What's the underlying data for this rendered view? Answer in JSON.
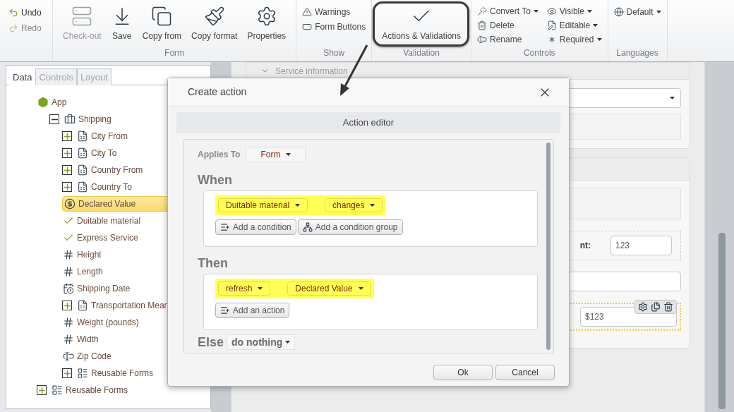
{
  "ribbon": {
    "quick": [
      {
        "label": "Undo",
        "disabled": false
      },
      {
        "label": "Redo",
        "disabled": true
      }
    ],
    "groups": [
      {
        "label": "Form",
        "items": [
          {
            "label": "Check-out",
            "kind": "large",
            "disabled": true
          },
          {
            "label": "Save",
            "kind": "large",
            "disabled": false
          },
          {
            "label": "Copy from",
            "kind": "large",
            "disabled": false
          },
          {
            "label": "Copy format",
            "kind": "large",
            "disabled": false
          },
          {
            "label": "Properties",
            "kind": "large",
            "disabled": false
          }
        ]
      },
      {
        "label": "Show",
        "items": [
          {
            "label": "Warnings",
            "kind": "small",
            "dropdown": false
          },
          {
            "label": "Form Buttons",
            "kind": "small",
            "dropdown": false
          }
        ]
      },
      {
        "label": "Validation",
        "items": [
          {
            "label": "Actions & Validations",
            "kind": "large",
            "disabled": false,
            "circled": true
          }
        ]
      },
      {
        "label": "Controls",
        "items": [
          {
            "label": "Convert To",
            "kind": "small",
            "dropdown": true
          },
          {
            "label": "Delete",
            "kind": "small",
            "dropdown": false
          },
          {
            "label": "Rename",
            "kind": "small",
            "dropdown": false
          },
          {
            "label": "Visible",
            "kind": "small",
            "dropdown": true
          },
          {
            "label": "Editable",
            "kind": "small",
            "dropdown": true
          },
          {
            "label": "Required",
            "kind": "small",
            "dropdown": true
          }
        ]
      },
      {
        "label": "Languages",
        "items": [
          {
            "label": "Default",
            "kind": "small",
            "dropdown": true
          }
        ]
      }
    ]
  },
  "panel": {
    "tabs": [
      {
        "label": "Data",
        "selected": true
      },
      {
        "label": "Controls",
        "selected": false
      },
      {
        "label": "Layout",
        "selected": false
      }
    ],
    "tree": [
      {
        "label": "App",
        "kind": "app",
        "children": [
          {
            "label": "Shipping",
            "kind": "group",
            "expanded": true,
            "children": [
              {
                "label": "City From",
                "kind": "list",
                "expanded": false
              },
              {
                "label": "City To",
                "kind": "list",
                "expanded": false
              },
              {
                "label": "Country From",
                "kind": "list",
                "expanded": false
              },
              {
                "label": "Country To",
                "kind": "list",
                "expanded": false
              },
              {
                "label": "Declared Value",
                "kind": "money",
                "selected": true
              },
              {
                "label": "Duitable material",
                "kind": "boolean",
                "selected": false
              },
              {
                "label": "Express Service",
                "kind": "boolean",
                "selected": false
              },
              {
                "label": "Height",
                "kind": "number",
                "selected": false
              },
              {
                "label": "Length",
                "kind": "number",
                "selected": false
              },
              {
                "label": "Shipping Date",
                "kind": "date",
                "selected": false
              },
              {
                "label": "Transportation Mean",
                "kind": "list",
                "expanded": false
              },
              {
                "label": "Weight (pounds)",
                "kind": "number",
                "selected": false
              },
              {
                "label": "Width",
                "kind": "number",
                "selected": false
              },
              {
                "label": "Zip Code",
                "kind": "text",
                "selected": false
              },
              {
                "label": "Reusable Forms",
                "kind": "forms",
                "expanded": false
              }
            ]
          }
        ]
      },
      {
        "label": "Reusable Forms",
        "kind": "forms",
        "expanded": false
      }
    ]
  },
  "form_preview": {
    "section_title": "Service information",
    "label": "nt:",
    "fields": [
      "123",
      "$123"
    ]
  },
  "dialog": {
    "title": "Create action",
    "section_title": "Action editor",
    "applies_to": {
      "label": "Applies To",
      "value": "Form"
    },
    "when": {
      "heading": "When",
      "highlighted": true,
      "items": [
        "Duitable material",
        "changes"
      ],
      "buttons": [
        "Add a condition",
        "Add a condition group"
      ]
    },
    "then": {
      "heading": "Then",
      "highlighted": true,
      "items": [
        "refresh",
        "Declared Value"
      ],
      "buttons": [
        "Add an action"
      ]
    },
    "else": {
      "heading": "Else",
      "value": "do nothing"
    },
    "buttons": [
      "Ok",
      "Cancel"
    ]
  }
}
